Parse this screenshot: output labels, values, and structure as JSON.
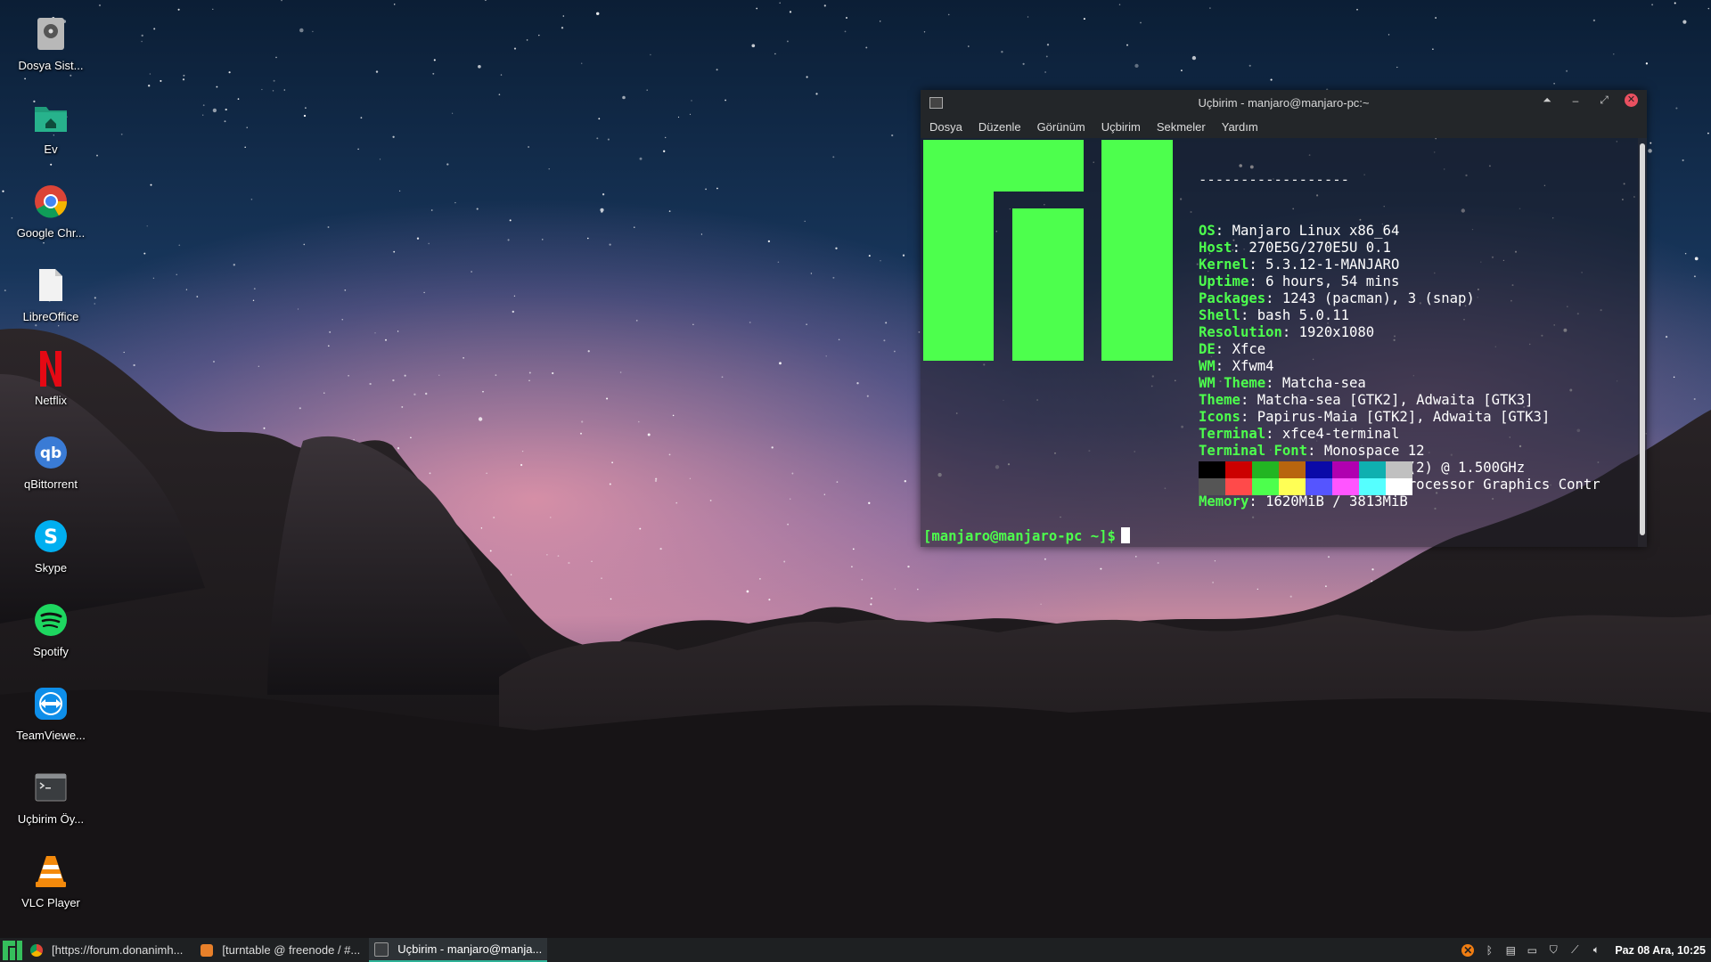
{
  "desktop": {
    "icons": [
      {
        "label": "Dosya Sist...",
        "icon": "harddisk-icon"
      },
      {
        "label": "Ev",
        "icon": "home-folder-icon"
      },
      {
        "label": "Google Chr...",
        "icon": "chrome-icon"
      },
      {
        "label": "LibreOffice",
        "icon": "document-icon"
      },
      {
        "label": "Netflix",
        "icon": "netflix-icon"
      },
      {
        "label": "qBittorrent",
        "icon": "qbittorrent-icon"
      },
      {
        "label": "Skype",
        "icon": "skype-icon"
      },
      {
        "label": "Spotify",
        "icon": "spotify-icon"
      },
      {
        "label": "TeamViewe...",
        "icon": "teamviewer-icon"
      },
      {
        "label": "Uçbirim Öy...",
        "icon": "terminal-icon"
      },
      {
        "label": "VLC Player",
        "icon": "vlc-icon"
      }
    ]
  },
  "terminal": {
    "title": "Uçbirim - manjaro@manjaro-pc:~",
    "menu": [
      "Dosya",
      "Düzenle",
      "Görünüm",
      "Uçbirim",
      "Sekmeler",
      "Yardım"
    ],
    "separator": "------------------",
    "info": [
      {
        "key": "OS",
        "value": "Manjaro Linux x86_64"
      },
      {
        "key": "Host",
        "value": "270E5G/270E5U 0.1"
      },
      {
        "key": "Kernel",
        "value": "5.3.12-1-MANJARO"
      },
      {
        "key": "Uptime",
        "value": "6 hours, 54 mins"
      },
      {
        "key": "Packages",
        "value": "1243 (pacman), 3 (snap)"
      },
      {
        "key": "Shell",
        "value": "bash 5.0.11"
      },
      {
        "key": "Resolution",
        "value": "1920x1080"
      },
      {
        "key": "DE",
        "value": "Xfce"
      },
      {
        "key": "WM",
        "value": "Xfwm4"
      },
      {
        "key": "WM Theme",
        "value": "Matcha-sea"
      },
      {
        "key": "Theme",
        "value": "Matcha-sea [GTK2], Adwaita [GTK3]"
      },
      {
        "key": "Icons",
        "value": "Papirus-Maia [GTK2], Adwaita [GTK3]"
      },
      {
        "key": "Terminal",
        "value": "xfce4-terminal"
      },
      {
        "key": "Terminal Font",
        "value": "Monospace 12"
      },
      {
        "key": "CPU",
        "value": "Intel Celeron 1007U (2) @ 1.500GHz"
      },
      {
        "key": "GPU",
        "value": "Intel 3rd Gen Core processor Graphics Contr"
      },
      {
        "key": "Memory",
        "value": "1620MiB / 3813MiB"
      }
    ],
    "palette_dark": [
      "#000000",
      "#cc0000",
      "#22b522",
      "#b8650e",
      "#0a0aa8",
      "#b000b0",
      "#0fb0b0",
      "#c0c0c0"
    ],
    "palette_bright": [
      "#555555",
      "#ff4a4a",
      "#4dff4d",
      "#ffff55",
      "#5555ff",
      "#ff55ff",
      "#55ffff",
      "#ffffff"
    ],
    "prompt": "[manjaro@manjaro-pc ~]$",
    "accent": "#4dff4d"
  },
  "taskbar": {
    "tasks": [
      {
        "label": "[https://forum.donanimh...",
        "icon": "chrome-icon",
        "active": false
      },
      {
        "label": "[turntable @ freenode / #...",
        "icon": "hexchat-icon",
        "active": false
      },
      {
        "label": "Uçbirim - manjaro@manja...",
        "icon": "terminal-icon",
        "active": true
      }
    ],
    "clock": "Paz 08 Ara, 10:25"
  }
}
